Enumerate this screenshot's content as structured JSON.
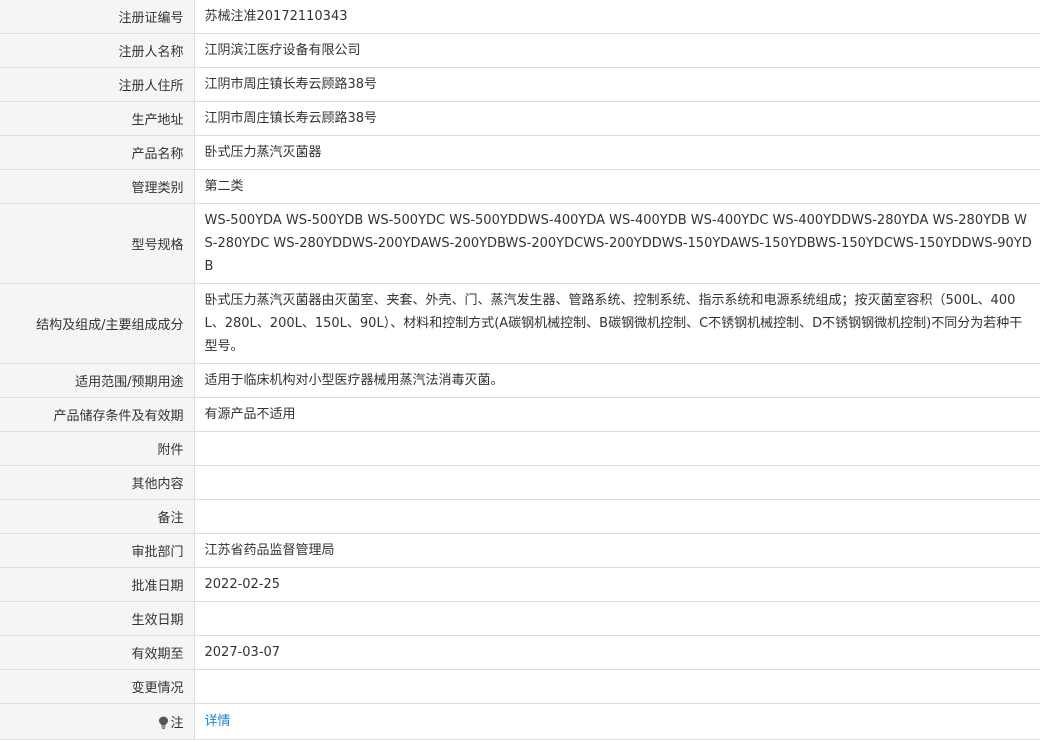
{
  "rows": [
    {
      "label": "注册证编号",
      "value": "苏械注准20172110343"
    },
    {
      "label": "注册人名称",
      "value": "江阴滨江医疗设备有限公司"
    },
    {
      "label": "注册人住所",
      "value": "江阴市周庄镇长寿云顾路38号"
    },
    {
      "label": "生产地址",
      "value": "江阴市周庄镇长寿云顾路38号"
    },
    {
      "label": "产品名称",
      "value": "卧式压力蒸汽灭菌器"
    },
    {
      "label": "管理类别",
      "value": "第二类"
    },
    {
      "label": "型号规格",
      "value": "WS-500YDA WS-500YDB WS-500YDC WS-500YDDWS-400YDA WS-400YDB WS-400YDC WS-400YDDWS-280YDA WS-280YDB WS-280YDC WS-280YDDWS-200YDAWS-200YDBWS-200YDCWS-200YDDWS-150YDAWS-150YDBWS-150YDCWS-150YDDWS-90YDB"
    },
    {
      "label": "结构及组成/主要组成成分",
      "value": "卧式压力蒸汽灭菌器由灭菌室、夹套、外壳、门、蒸汽发生器、管路系统、控制系统、指示系统和电源系统组成；按灭菌室容积（500L、400L、280L、200L、150L、90L）、材料和控制方式(A碳钢机械控制、B碳钢微机控制、C不锈钢机械控制、D不锈钢钢微机控制)不同分为若种干型号。"
    },
    {
      "label": "适用范围/预期用途",
      "value": "适用于临床机构对小型医疗器械用蒸汽法消毒灭菌。"
    },
    {
      "label": "产品储存条件及有效期",
      "value": "有源产品不适用"
    },
    {
      "label": "附件",
      "value": ""
    },
    {
      "label": "其他内容",
      "value": ""
    },
    {
      "label": "备注",
      "value": ""
    },
    {
      "label": "审批部门",
      "value": "江苏省药品监督管理局"
    },
    {
      "label": "批准日期",
      "value": "2022-02-25"
    },
    {
      "label": "生效日期",
      "value": ""
    },
    {
      "label": "有效期至",
      "value": "2027-03-07"
    },
    {
      "label": "变更情况",
      "value": ""
    }
  ],
  "note": {
    "icon": "lightbulb-icon",
    "label": "注",
    "link_text": "详情",
    "link_color": "#1e7fd2"
  }
}
